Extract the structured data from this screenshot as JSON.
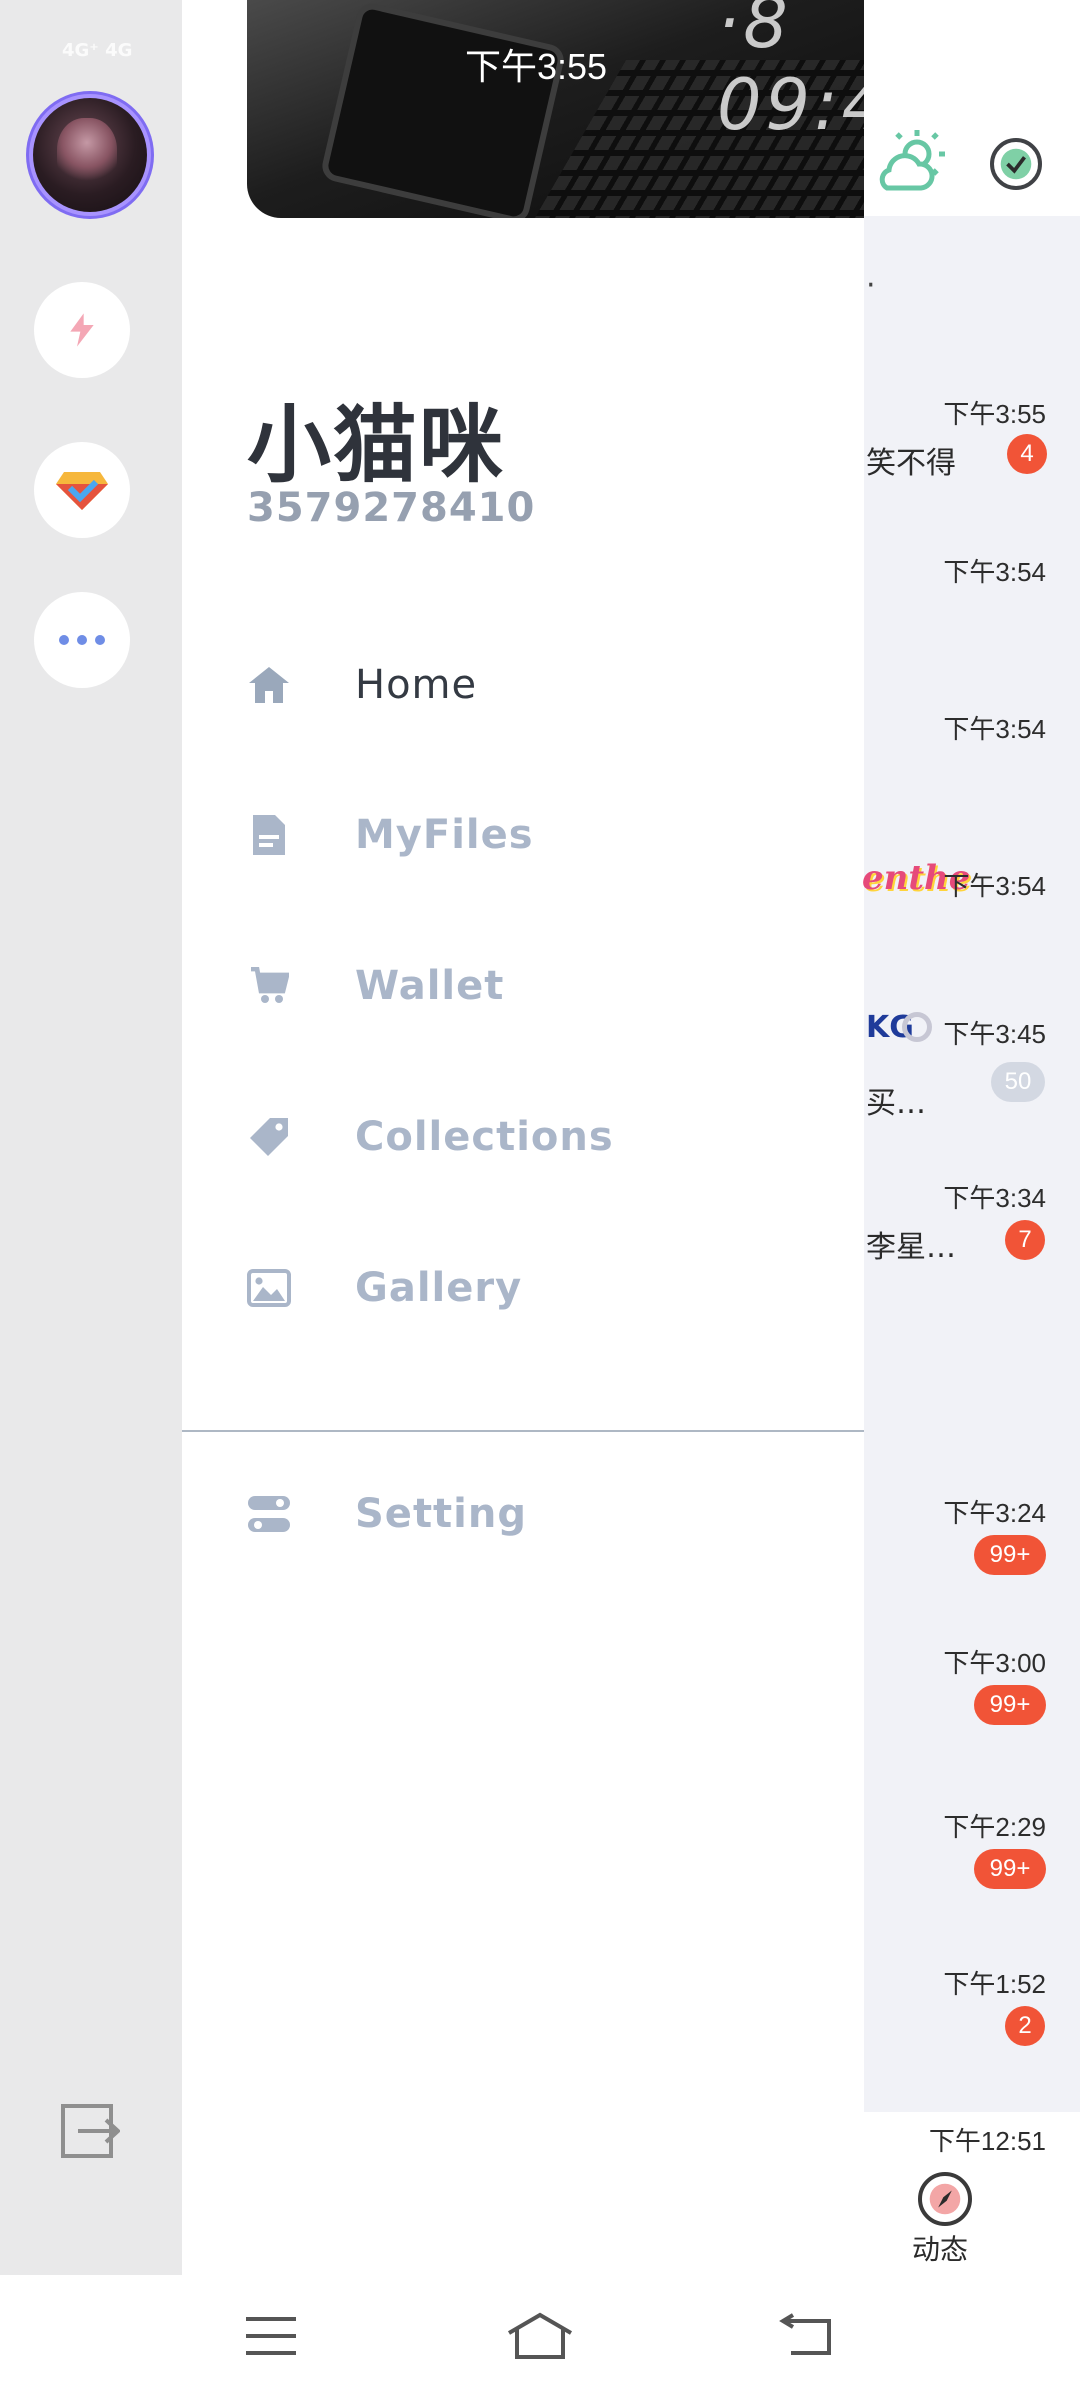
{
  "status_bar": {
    "time": "下午3:55",
    "network": "4G⁺ 4G"
  },
  "profile": {
    "name": "小猫咪",
    "id": "3579278410"
  },
  "menu": {
    "items": [
      {
        "label": "Home",
        "icon": "home-icon",
        "active": true
      },
      {
        "label": "MyFiles",
        "icon": "file-icon",
        "active": false
      },
      {
        "label": "Wallet",
        "icon": "cart-icon",
        "active": false
      },
      {
        "label": "Collections",
        "icon": "tag-icon",
        "active": false
      },
      {
        "label": "Gallery",
        "icon": "image-icon",
        "active": false
      }
    ],
    "setting": {
      "label": "Setting",
      "icon": "toggle-icon"
    }
  },
  "conversations": {
    "top_snippet": "·",
    "rows": [
      {
        "time": "下午3:55",
        "snippet": "笑不得",
        "badge": "4"
      },
      {
        "time": "下午3:54",
        "snippet": "",
        "badge": ""
      },
      {
        "time": "下午3:54",
        "snippet": "",
        "badge": ""
      },
      {
        "time": "下午3:54",
        "snippet": "",
        "badge": "",
        "sticker": "enthe"
      },
      {
        "time": "下午3:45",
        "snippet": "买…",
        "badge": "50",
        "logo": "KG"
      },
      {
        "time": "下午3:34",
        "snippet": "李星…",
        "badge": "7"
      },
      {
        "time": "下午3:24",
        "snippet": "",
        "badge": "99+"
      },
      {
        "time": "下午3:00",
        "snippet": "",
        "badge": "99+"
      },
      {
        "time": "下午2:29",
        "snippet": "",
        "badge": "99+"
      },
      {
        "time": "下午1:52",
        "snippet": "",
        "badge": "2"
      },
      {
        "time": "下午12:51",
        "snippet": "",
        "badge": ""
      }
    ]
  },
  "bottom_tab": {
    "label": "动态"
  },
  "colors": {
    "badge": "#f15437",
    "muted_menu": "#aab6c9",
    "active_menu": "#343a43",
    "rail": "#e9e9ea"
  }
}
